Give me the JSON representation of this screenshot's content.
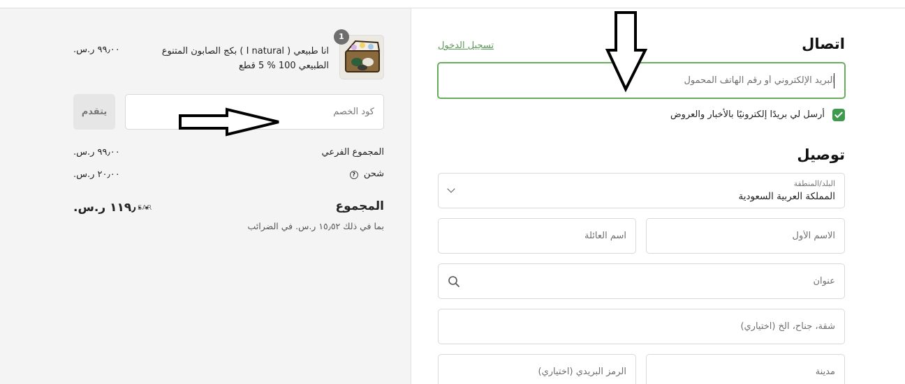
{
  "contact": {
    "heading": "اتصال",
    "login_link": "تسجيل الدخول",
    "email_placeholder": "البريد الإلكتروني أو رقم الهاتف المحمول",
    "newsletter_label": "أرسل لي بريدًا إلكترونيًا بالأخبار والعروض",
    "newsletter_checked": true
  },
  "delivery": {
    "heading": "توصيل",
    "country_label": "البلد/المنطقة",
    "country_value": "المملكة العربية السعودية",
    "first_name_placeholder": "الاسم الأول",
    "last_name_placeholder": "اسم العائلة",
    "address_placeholder": "عنوان",
    "apartment_placeholder": "شقة، جناح، الخ (اختياري)",
    "city_placeholder": "مدينة",
    "postal_placeholder": "الرمز البريدي (اختياري)"
  },
  "summary": {
    "product": {
      "name": "انا طبيعي ( I natural ) بكج الصابون المتنوع الطبيعي 100 % 5 قطع",
      "price": "٩٩٫٠٠ ر.س.",
      "quantity": "1",
      "image_icon": "soap-box-icon"
    },
    "discount_placeholder": "كود الخصم",
    "apply_label": "يتقدم",
    "subtotal_label": "المجموع الفرعي",
    "subtotal_value": "٩٩٫٠٠ ر.س.",
    "shipping_label": "شحن",
    "shipping_value": "٢٠٫٠٠ ر.س.",
    "total_label": "المجموع",
    "total_currency": "SAR",
    "total_value": "١١٩٫٠٠ ر.س.",
    "tax_note": "بما في ذلك ١٥٫٥٢ ر.س. في الضرائب"
  },
  "colors": {
    "accent": "#67ad5b",
    "link": "#5a9a58",
    "checkbox": "#3f9a4e",
    "summary_bg": "#f4f4f4"
  }
}
